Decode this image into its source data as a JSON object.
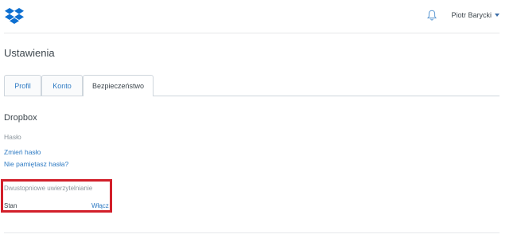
{
  "header": {
    "logo_icon": "dropbox-logo-icon",
    "notification_icon": "bell-icon",
    "user_name": "Piotr Barycki",
    "accent_color": "#2d7ac3"
  },
  "page": {
    "title": "Ustawienia"
  },
  "tabs": [
    {
      "label": "Profil",
      "active": false
    },
    {
      "label": "Konto",
      "active": false
    },
    {
      "label": "Bezpieczeństwo",
      "active": true
    }
  ],
  "security": {
    "section_title": "Dropbox",
    "password_label": "Hasło",
    "change_password_link": "Zmień hasło",
    "forgot_password_link": "Nie pamiętasz hasła?",
    "two_factor": {
      "title": "Dwustopniowe uwierzytelnianie",
      "status_label": "Stan",
      "enable_link": "Włącz",
      "highlight_color": "#d21f2a"
    }
  }
}
